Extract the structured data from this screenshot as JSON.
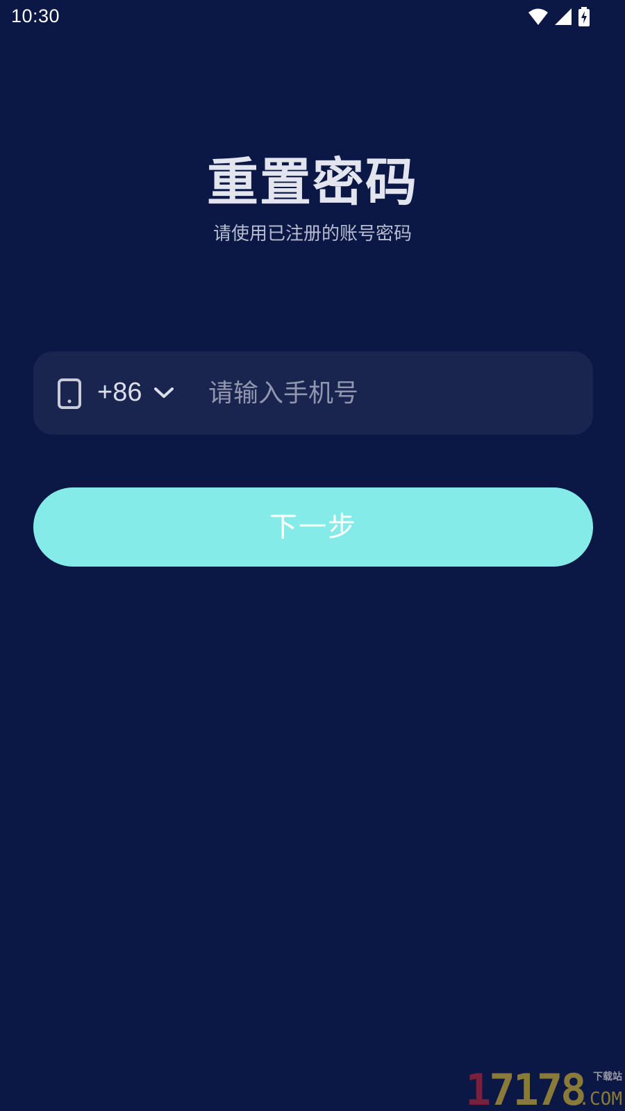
{
  "status_bar": {
    "time": "10:30",
    "icons": [
      "wifi-icon",
      "cellular-signal-icon",
      "battery-charging-icon"
    ]
  },
  "header": {
    "title": "重置密码",
    "subtitle": "请使用已注册的账号密码"
  },
  "phone_field": {
    "icon": "phone-icon",
    "country_code": "+86",
    "dropdown_icon": "chevron-down-icon",
    "value": "",
    "placeholder": "请输入手机号"
  },
  "next_button": {
    "label": "下一步",
    "color": "#85ebe8"
  },
  "watermark": {
    "number_first": "1",
    "number_rest": "7178",
    "site": "下载站",
    "domain": ".COM"
  },
  "colors": {
    "background": "#0b1744",
    "field_background": "#19244f",
    "title_text": "#e3e5ee"
  }
}
